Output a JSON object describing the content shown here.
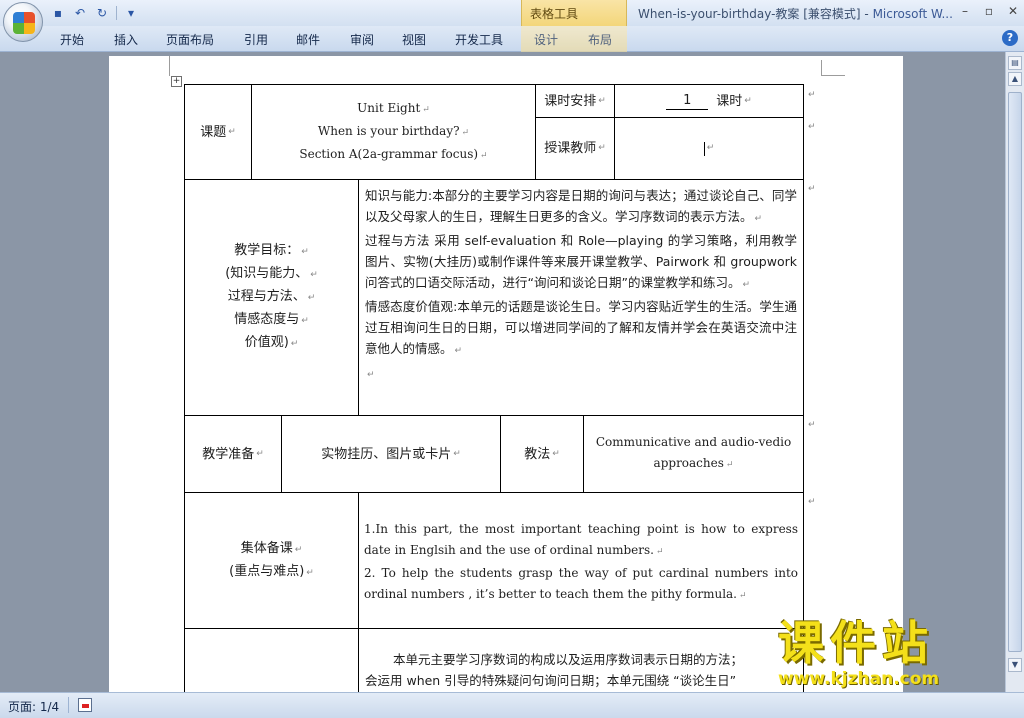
{
  "window": {
    "title": "When-is-your-birthday-教案 [兼容模式] - ",
    "app_name": "Microsoft W...",
    "context_tool_label": "表格工具",
    "controls": [
      "–",
      "▫",
      "✕"
    ]
  },
  "quick_access": {
    "icons": [
      "save-icon",
      "undo-icon",
      "redo-icon",
      "customize-icon"
    ],
    "glyphs": {
      "save": "▪",
      "undo": "↶",
      "redo": "↻",
      "customize": "▾"
    }
  },
  "ribbon": {
    "tabs": [
      "开始",
      "插入",
      "页面布局",
      "引用",
      "邮件",
      "审阅",
      "视图",
      "开发工具",
      "设计",
      "布局"
    ],
    "help": "?"
  },
  "table": {
    "row1": {
      "label": "课题",
      "title_lines": [
        "Unit Eight",
        "When is your birthday?",
        "Section A(2a-grammar focus)"
      ],
      "schedule_label": "课时安排",
      "schedule_value": "1",
      "schedule_unit": "课时",
      "teacher_label": "授课教师",
      "teacher_value": ""
    },
    "row2": {
      "label_lines": [
        "教学目标：",
        "(知识与能力、",
        "过程与方法、",
        "情感态度与",
        "价值观)"
      ],
      "paragraphs": [
        "知识与能力:本部分的主要学习内容是日期的询问与表达；通过谈论自己、同学以及父母家人的生日，理解生日更多的含义。学习序数词的表示方法。",
        "过程与方法  采用 self-evaluation 和 Role—playing 的学习策略，利用教学图片、实物(大挂历)或制作课件等来展开课堂教学、Pairwork 和 groupwork 问答式的口语交际活动，进行“询问和谈论日期”的课堂教学和练习。",
        "情感态度价值观:本单元的话题是谈论生日。学习内容贴近学生的生活。学生通过互相询问生日的日期，可以增进同学间的了解和友情并学会在英语交流中注意他人的情感。"
      ]
    },
    "row3": {
      "prep_label": "教学准备",
      "prep_value": "实物挂历、图片或卡片",
      "method_label": "教法",
      "method_value_lines": [
        "Communicative and audio-vedio",
        "approaches"
      ]
    },
    "row4": {
      "label_lines": [
        "集体备课",
        "(重点与难点)"
      ],
      "paragraphs": [
        "1.In this part, the most important teaching point is how to express date in Englsih and the use of ordinal numbers.",
        "2. To help the students grasp the way of put cardinal numbers into ordinal numbers , it’s better to teach them the pithy formula."
      ]
    },
    "row5": {
      "paragraph_lines": [
        "本单元主要学习序数词的构成以及运用序数词表示日期的方法；",
        "会运用 when 引导的特殊疑问句询问日期；本单元围绕 “谈论生日”"
      ]
    },
    "para_mark": "↵"
  },
  "watermark": {
    "text": "课件站",
    "url": "www.kjzhan.com"
  },
  "statusbar": {
    "page": "页面: 1/4"
  },
  "colors": {
    "accent": "#2a56a5",
    "watermark": "#f4e01a",
    "context_tab": "#f3d67a"
  }
}
